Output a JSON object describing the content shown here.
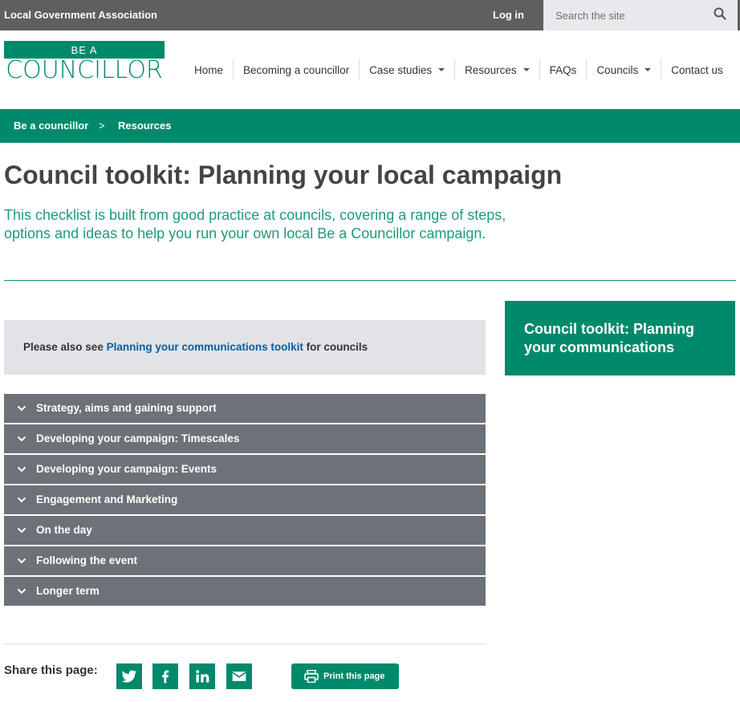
{
  "topbar": {
    "org_name": "Local Government Association",
    "login_label": "Log in",
    "search_placeholder": "Search the site"
  },
  "logo": {
    "be_a": "BE A",
    "word": "COUNCILLOR"
  },
  "nav": {
    "items": [
      {
        "label": "Home",
        "dropdown": false
      },
      {
        "label": "Becoming a councillor",
        "dropdown": false
      },
      {
        "label": "Case studies",
        "dropdown": true
      },
      {
        "label": "Resources",
        "dropdown": true
      },
      {
        "label": "FAQs",
        "dropdown": false
      },
      {
        "label": "Councils",
        "dropdown": true
      },
      {
        "label": "Contact us",
        "dropdown": false
      }
    ]
  },
  "breadcrumb": {
    "items": [
      "Be a councillor",
      "Resources"
    ],
    "separator": ">"
  },
  "page": {
    "title": "Council toolkit: Planning your local campaign",
    "intro": "This checklist is built from good practice at councils, covering a range of steps, options and ideas to help you run your own local Be a Councillor campaign."
  },
  "notice": {
    "prefix": "Please also see ",
    "link": "Planning your communications toolkit",
    "suffix": " for councils"
  },
  "accordion": {
    "items": [
      "Strategy, aims and gaining support",
      "Developing your campaign: Timescales",
      "Developing your campaign: Events",
      "Engagement and Marketing",
      "On the day",
      "Following the event",
      "Longer term"
    ]
  },
  "sidebar": {
    "card_title": "Council toolkit: Planning your communications"
  },
  "share": {
    "label": "Share this page:",
    "icons": [
      "twitter-icon",
      "facebook-icon",
      "linkedin-icon",
      "email-icon"
    ],
    "print_label": "Print this page"
  },
  "colors": {
    "brand_green": "#008a6b",
    "topbar_grey": "#5f5f5f",
    "accordion_grey": "#6d7178",
    "link_blue": "#0b5d9c"
  }
}
